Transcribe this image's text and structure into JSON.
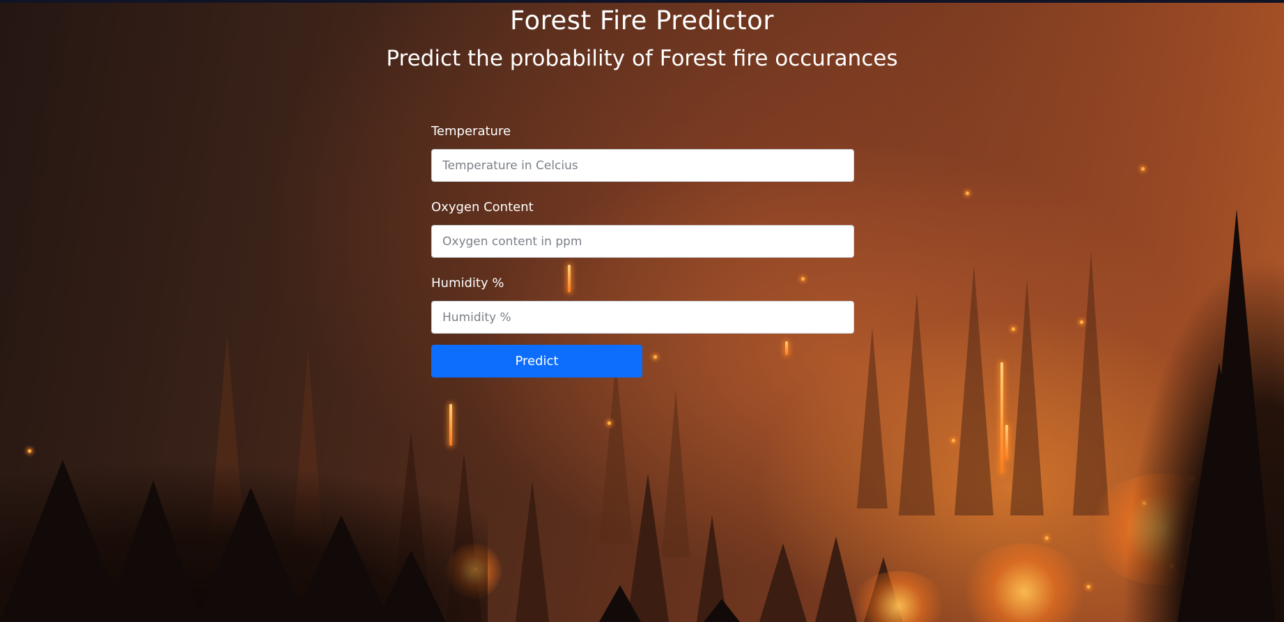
{
  "header": {
    "title": "Forest Fire Predictor",
    "subtitle": "Predict the probability of Forest fire occurances"
  },
  "form": {
    "fields": [
      {
        "label": "Temperature",
        "placeholder": "Temperature in Celcius",
        "value": ""
      },
      {
        "label": "Oxygen Content",
        "placeholder": "Oxygen content in ppm",
        "value": ""
      },
      {
        "label": "Humidity %",
        "placeholder": "Humidity %",
        "value": ""
      }
    ],
    "submit_label": "Predict"
  },
  "colors": {
    "accent": "#0d6efd",
    "text": "#ffffff"
  },
  "background_image": "forest-fire-at-night"
}
